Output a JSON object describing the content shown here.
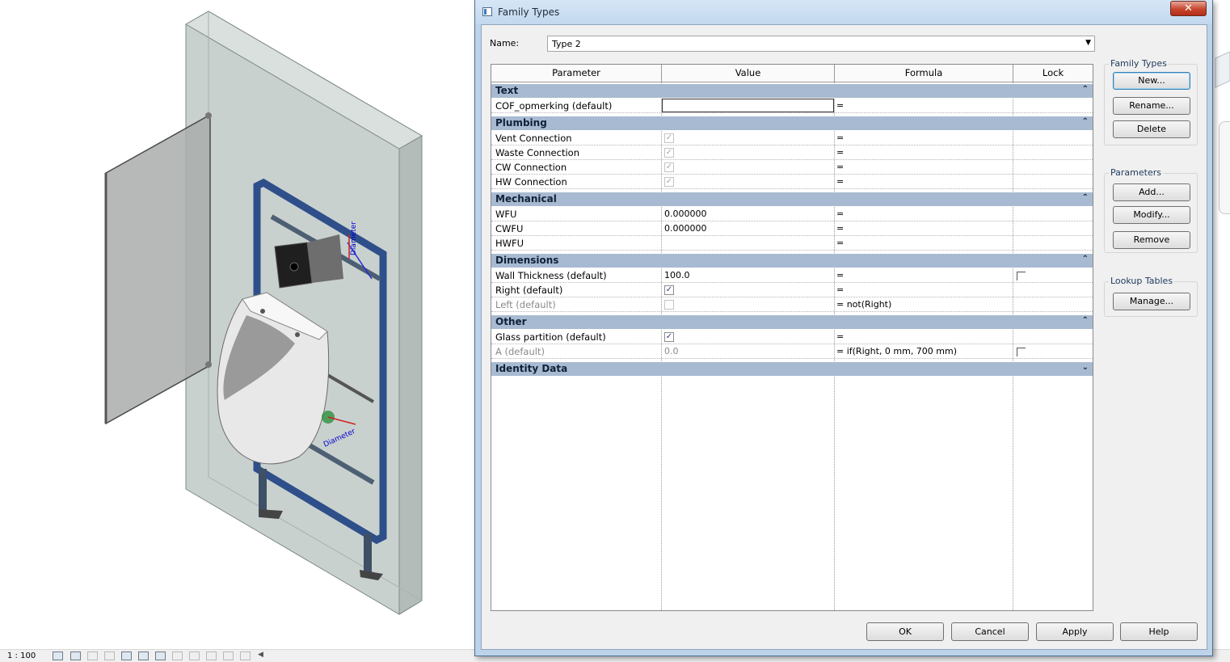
{
  "viewport": {
    "scale": "1 : 100",
    "annotation_top": "Diameter",
    "annotation_bottom": "Diameter"
  },
  "dialog": {
    "title": "Family Types",
    "close_label": "✕",
    "name_label": "Name:",
    "name_value": "Type 2",
    "columns": {
      "parameter": "Parameter",
      "value": "Value",
      "formula": "Formula",
      "lock": "Lock"
    },
    "groups": {
      "text": {
        "label": "Text",
        "chevron": "⌃"
      },
      "plumbing": {
        "label": "Plumbing",
        "chevron": "⌃"
      },
      "mechanical": {
        "label": "Mechanical",
        "chevron": "⌃"
      },
      "dimensions": {
        "label": "Dimensions",
        "chevron": "⌃"
      },
      "other": {
        "label": "Other",
        "chevron": "⌃"
      },
      "identity": {
        "label": "Identity Data",
        "chevron": "⌄"
      }
    },
    "rows": {
      "cof": {
        "param": "COF_opmerking (default)",
        "value": "",
        "formula": "="
      },
      "vent": {
        "param": "Vent Connection",
        "checked": true,
        "formula": "="
      },
      "waste": {
        "param": "Waste Connection",
        "checked": true,
        "formula": "="
      },
      "cw": {
        "param": "CW Connection",
        "checked": true,
        "formula": "="
      },
      "hw": {
        "param": "HW Connection",
        "checked": true,
        "formula": "="
      },
      "wfu": {
        "param": "WFU",
        "value": "0.000000",
        "formula": "="
      },
      "cwfu": {
        "param": "CWFU",
        "value": "0.000000",
        "formula": "="
      },
      "hwfu": {
        "param": "HWFU",
        "value": "",
        "formula": "="
      },
      "wall": {
        "param": "Wall Thickness (default)",
        "value": "100.0",
        "formula": "=",
        "locked": false
      },
      "right": {
        "param": "Right (default)",
        "checked": true,
        "formula": "="
      },
      "left": {
        "param": "Left (default)",
        "checked": false,
        "formula": "=  not(Right)"
      },
      "glass": {
        "param": "Glass partition (default)",
        "checked": true,
        "formula": "="
      },
      "a": {
        "param": "A (default)",
        "value": "0.0",
        "formula": "=  if(Right, 0 mm, 700 mm)",
        "locked": false
      }
    },
    "check_glyph": "✓",
    "dropdown_glyph": "▼",
    "family_types": {
      "title": "Family Types",
      "new": "New...",
      "rename": "Rename...",
      "delete": "Delete"
    },
    "parameters": {
      "title": "Parameters",
      "add": "Add...",
      "modify": "Modify...",
      "remove": "Remove"
    },
    "lookup": {
      "title": "Lookup Tables",
      "manage": "Manage..."
    },
    "footer": {
      "ok": "OK",
      "cancel": "Cancel",
      "apply": "Apply",
      "help": "Help"
    }
  }
}
